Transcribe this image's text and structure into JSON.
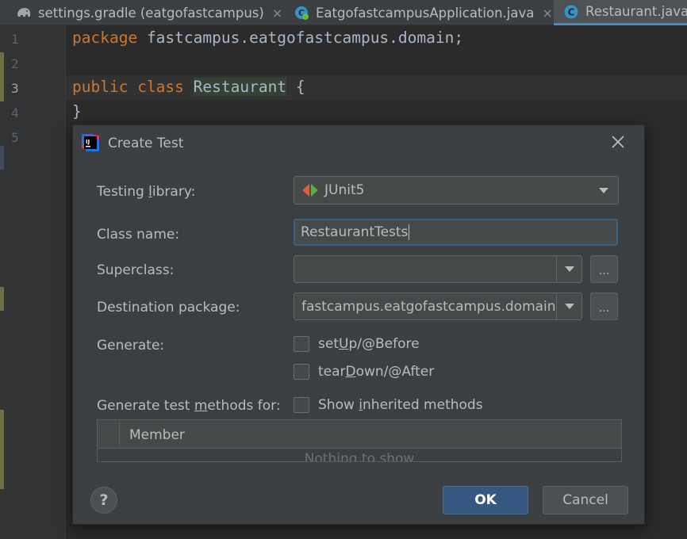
{
  "tabs": [
    {
      "label": "settings.gradle (eatgofastcampus)",
      "icon": "gradle-elephant-icon"
    },
    {
      "label": "EatgofastcampusApplication.java",
      "icon": "spring-class-icon"
    },
    {
      "label": "Restaurant.java",
      "icon": "class-c-icon"
    }
  ],
  "tab_close": "×",
  "editor": {
    "line_numbers": [
      "1",
      "2",
      "3",
      "4",
      "5"
    ],
    "line1": {
      "keyword": "package",
      "rest": "fastcampus.eatgofastcampus.domain;"
    },
    "line3": {
      "kw1": "public",
      "kw2": "class",
      "name": "Restaurant",
      "brace": "{"
    },
    "line4": {
      "brace": "}"
    }
  },
  "dialog": {
    "title": "Create Test",
    "testing_library": {
      "label_pre": "Testing ",
      "label_u": "l",
      "label_post": "ibrary:",
      "value": "JUnit5"
    },
    "class_name": {
      "label": "Class name:",
      "value": "RestaurantTests"
    },
    "superclass": {
      "label": "Superclass:",
      "value": "",
      "browse": "..."
    },
    "destination_package": {
      "label": "Destination package:",
      "value": "fastcampus.eatgofastcampus.domain",
      "browse": "..."
    },
    "generate": {
      "label": "Generate:",
      "setup": {
        "pre": "set",
        "u": "U",
        "post": "p/@Before"
      },
      "teardown": {
        "pre": "tear",
        "u": "D",
        "post": "own/@After"
      }
    },
    "methods": {
      "label_pre": "Generate test ",
      "label_u": "m",
      "label_post": "ethods for:",
      "inherited_pre": "Show ",
      "inherited_u": "i",
      "inherited_post": "nherited methods"
    },
    "table": {
      "header": "Member",
      "empty": "Nothing to show"
    },
    "help": "?",
    "ok": "OK",
    "cancel": "Cancel"
  },
  "colors": {
    "accent": "#365880",
    "focus_border": "#3d6185",
    "keyword": "#cc7832"
  }
}
